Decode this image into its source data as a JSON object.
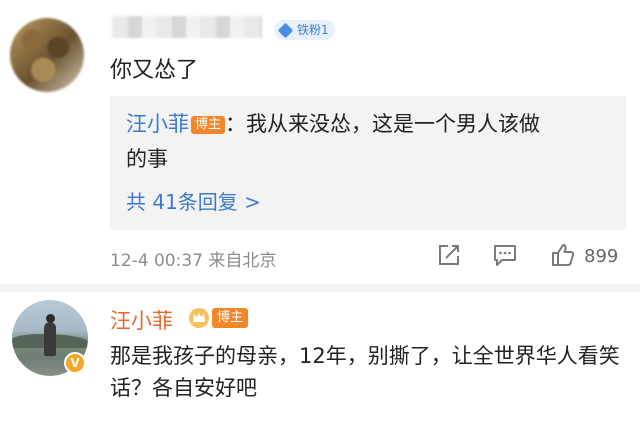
{
  "comment1": {
    "fan_badge": "铁粉1",
    "text": "你又怂了",
    "reply": {
      "author": "汪小菲",
      "author_tag": "博主",
      "line1": "：我从来没怂，这是一个男人该做",
      "line2": "的事",
      "more": "共 41条回复 >"
    },
    "meta": "12-4 00:37 来自北京",
    "likes": "899"
  },
  "comment2": {
    "author": "汪小菲",
    "author_tag": "博主",
    "text": "那是我孩子的母亲，12年，别撕了，让全世界华人看笑话？各自安好吧"
  },
  "colors": {
    "link_blue": "#3c7ad0",
    "vip_orange": "#e8692a",
    "tag_orange": "#f2862a"
  },
  "icons": [
    "share-icon",
    "comment-icon",
    "like-icon",
    "crown-icon",
    "verified-v-icon",
    "diamond-icon"
  ]
}
